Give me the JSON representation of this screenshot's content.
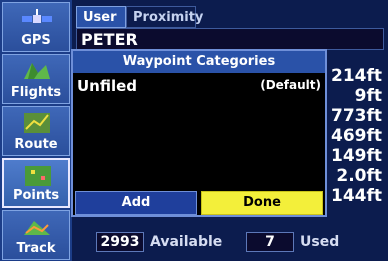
{
  "sidebar": {
    "items": [
      {
        "label": "GPS",
        "icon": "satellite-icon",
        "active": false
      },
      {
        "label": "Flights",
        "icon": "map-icon",
        "active": false
      },
      {
        "label": "Route",
        "icon": "route-icon",
        "active": false
      },
      {
        "label": "Points",
        "icon": "waypoint-icon",
        "active": true
      },
      {
        "label": "Track",
        "icon": "track-icon",
        "active": false
      }
    ]
  },
  "tabs": {
    "user": "User",
    "proximity": "Proximity"
  },
  "background": {
    "name_field": "PETER",
    "values": [
      "214ft",
      "9ft",
      "773ft",
      "469ft",
      "149ft",
      "2.0ft",
      "144ft"
    ]
  },
  "dialog": {
    "title": "Waypoint Categories",
    "rows": [
      {
        "name": "Unfiled",
        "tag": "(Default)"
      }
    ],
    "add_label": "Add",
    "done_label": "Done"
  },
  "footer": {
    "available_count": "2993",
    "available_label": "Available",
    "used_count": "7",
    "used_label": "Used"
  },
  "colors": {
    "background": "#0c1c4e",
    "sidebar": "#1c3d88",
    "dialog_title": "#2a52a8",
    "done_button": "#f3ef3a",
    "add_button": "#1f3f9c"
  }
}
